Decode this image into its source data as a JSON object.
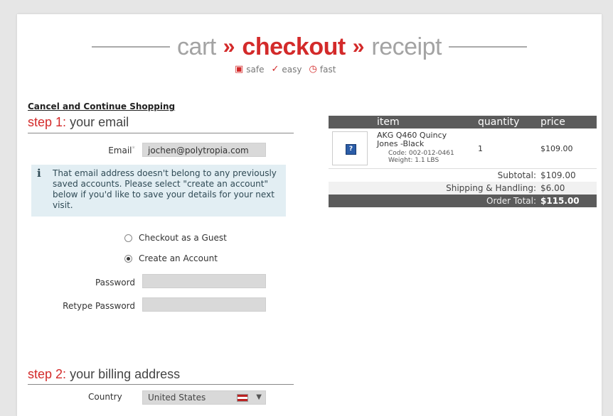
{
  "progress": {
    "steps": [
      "cart",
      "checkout",
      "receipt"
    ],
    "separator": "»",
    "active_step": "checkout"
  },
  "badges": [
    {
      "icon": "lock-icon",
      "label": "safe"
    },
    {
      "icon": "check-icon",
      "label": "easy"
    },
    {
      "icon": "clock-icon",
      "label": "fast"
    }
  ],
  "cancel_link": "Cancel and Continue Shopping",
  "step1": {
    "number": "step 1",
    "colon": ":",
    "title": "your email",
    "email_label": "Email",
    "required_mark": "*",
    "email_value": "jochen@polytropia.com",
    "info_text": "That email address doesn't belong to any previously saved accounts. Please select \"create an account\" below if you'd like to save your details for your next visit.",
    "radio_guest": "Checkout as a Guest",
    "radio_account": "Create an Account",
    "selected_option": "Create an Account",
    "password_label": "Password",
    "retype_label": "Retype Password"
  },
  "step2": {
    "number": "step 2",
    "colon": ":",
    "title": "your billing address",
    "country_label": "Country",
    "country_value": "United States"
  },
  "cart": {
    "headers": {
      "item": "item",
      "quantity": "quantity",
      "price": "price"
    },
    "items": [
      {
        "name": "AKG Q460 Quincy Jones -Black",
        "code": "Code: 002-012-0461",
        "weight": "Weight: 1.1 LBS",
        "quantity": "1",
        "price": "$109.00"
      }
    ],
    "subtotal_label": "Subtotal:",
    "subtotal": "$109.00",
    "shipping_label": "Shipping & Handling:",
    "shipping": "$6.00",
    "total_label": "Order Total:",
    "total": "$115.00"
  },
  "colors": {
    "accent": "#d32a2a",
    "inactive_step": "#a3a3a3",
    "table_header": "#5b5b5b",
    "info_bg": "#e2eef3"
  }
}
